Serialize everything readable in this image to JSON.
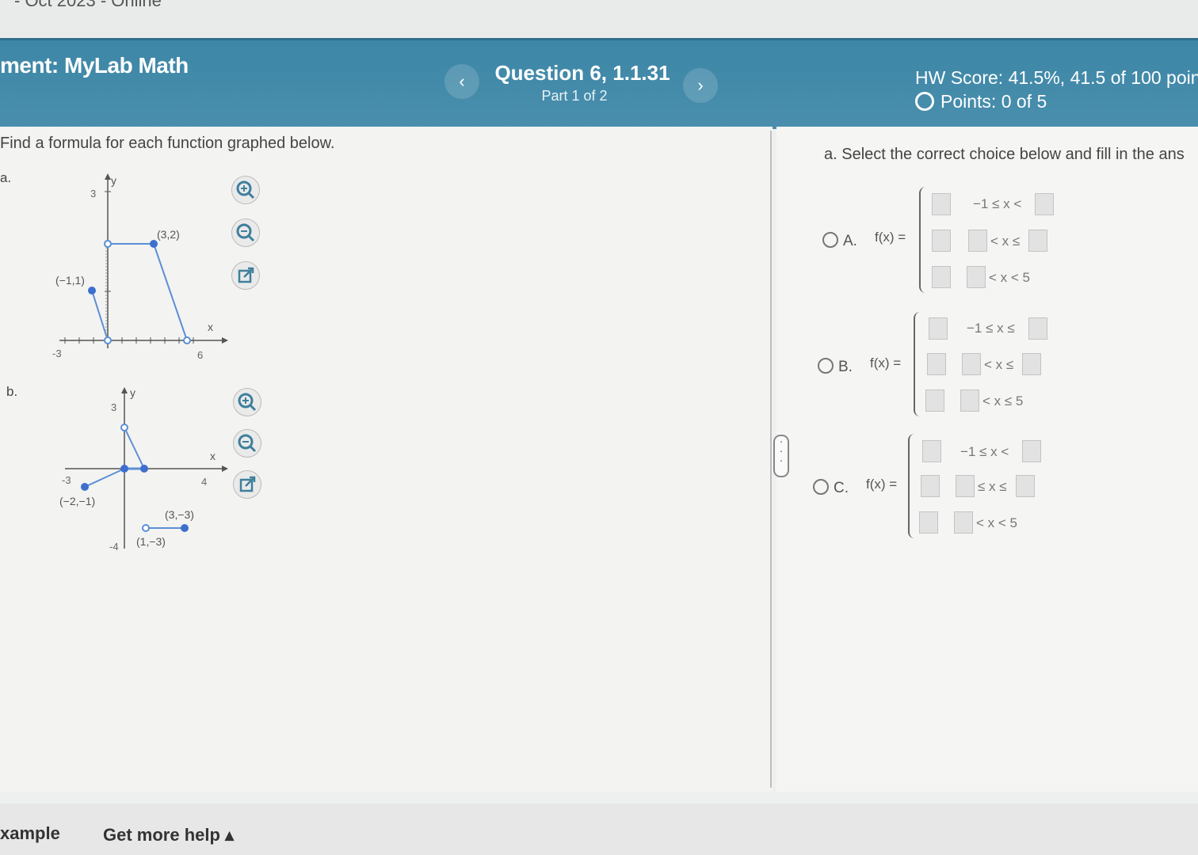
{
  "browser": {
    "tab_title": "- Oct 2023 - Online"
  },
  "header": {
    "assignment": "ment: MyLab Math",
    "prev_icon": "chevron-left-icon",
    "next_icon": "chevron-right-icon",
    "question_title": "Question 6, 1.1.31",
    "question_part": "Part 1 of 2",
    "hw_score": "HW Score: 41.5%, 41.5 of 100 poin",
    "points": "Points: 0 of 5"
  },
  "left": {
    "instruction": "Find a formula for each function graphed below.",
    "part_a": {
      "label": "a.",
      "y_label": "y",
      "x_label": "x",
      "tick_y": "3",
      "tick_x_left": "-3",
      "tick_x_right": "6",
      "point_1": "(3,2)",
      "point_2": "(−1,1)"
    },
    "part_b": {
      "label": "b.",
      "y_label": "y",
      "x_label": "x",
      "tick_y_top": "3",
      "tick_y_bottom": "-4",
      "tick_x_left": "-3",
      "tick_x_right": "4",
      "point_1": "(−2,−1)",
      "point_2": "(3,−3)",
      "point_3": "(1,−3)"
    },
    "graph_tools": [
      "zoom-in-icon",
      "zoom-out-icon",
      "open-external-icon"
    ]
  },
  "right": {
    "instruction": "a. Select the correct choice below and fill in the ans",
    "choices": [
      {
        "letter": "A.",
        "fx": "f(x) =",
        "conds": [
          "−1 ≤ x <",
          "< x ≤",
          "< x < 5"
        ]
      },
      {
        "letter": "B.",
        "fx": "f(x) =",
        "conds": [
          "−1 ≤ x ≤",
          "< x ≤",
          "< x ≤ 5"
        ]
      },
      {
        "letter": "C.",
        "fx": "f(x) =",
        "conds": [
          "−1 ≤ x <",
          "≤ x ≤",
          "< x < 5"
        ]
      }
    ]
  },
  "footer": {
    "example": "xample",
    "more_help": "Get more help ▴"
  },
  "colors": {
    "header": "#4a8fad",
    "point": "#3d6fcf"
  }
}
